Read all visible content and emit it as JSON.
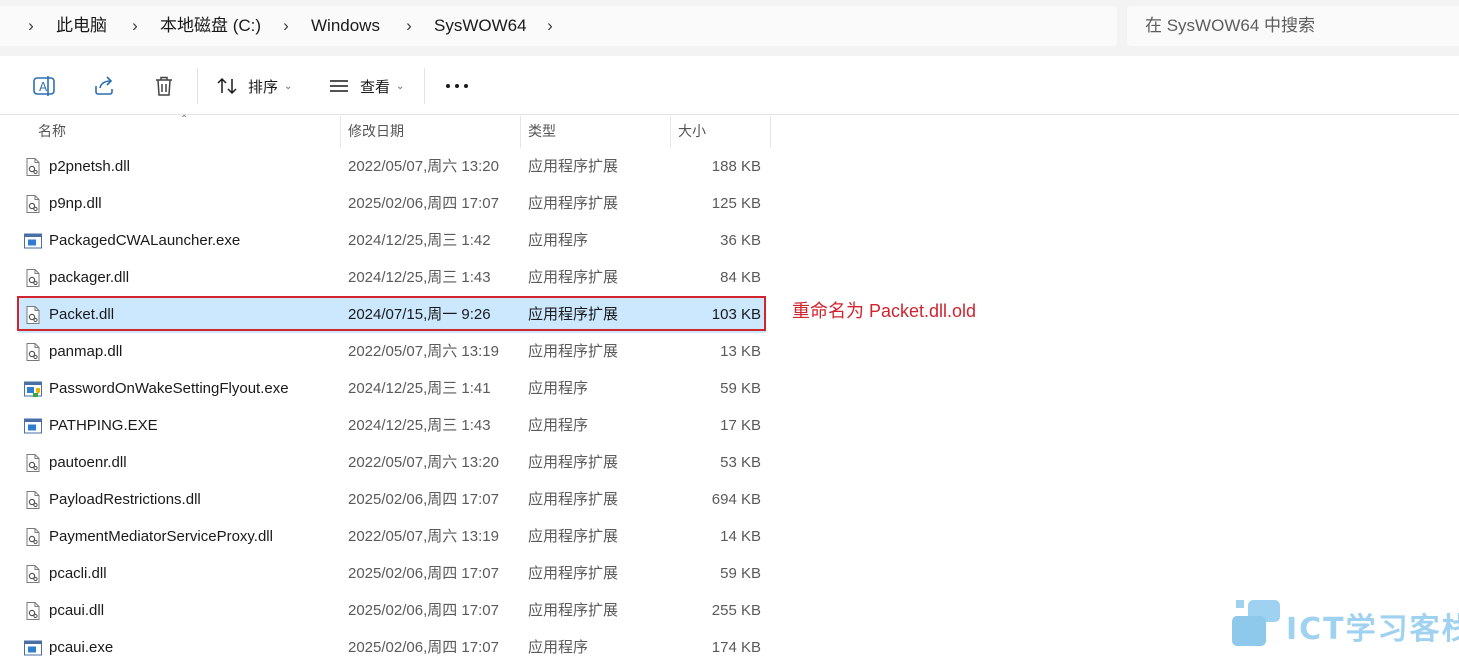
{
  "breadcrumb": {
    "items": [
      "此电脑",
      "本地磁盘 (C:)",
      "Windows",
      "SysWOW64"
    ]
  },
  "search": {
    "placeholder": "在 SysWOW64 中搜索"
  },
  "toolbar": {
    "sort_label": "排序",
    "view_label": "查看",
    "more_icon": "ellipsis-icon"
  },
  "columns": {
    "name": "名称",
    "modified": "修改日期",
    "type": "类型",
    "size": "大小"
  },
  "files": [
    {
      "name": "p2pnetsh.dll",
      "modified": "2022/05/07,周六 13:20",
      "type": "应用程序扩展",
      "size": "188 KB",
      "icon": "dll-icon"
    },
    {
      "name": "p9np.dll",
      "modified": "2025/02/06,周四 17:07",
      "type": "应用程序扩展",
      "size": "125 KB",
      "icon": "dll-icon"
    },
    {
      "name": "PackagedCWALauncher.exe",
      "modified": "2024/12/25,周三 1:42",
      "type": "应用程序",
      "size": "36 KB",
      "icon": "exe-icon"
    },
    {
      "name": "packager.dll",
      "modified": "2024/12/25,周三 1:43",
      "type": "应用程序扩展",
      "size": "84 KB",
      "icon": "dll-icon"
    },
    {
      "name": "Packet.dll",
      "modified": "2024/07/15,周一 9:26",
      "type": "应用程序扩展",
      "size": "103 KB",
      "icon": "dll-icon",
      "selected": true
    },
    {
      "name": "panmap.dll",
      "modified": "2022/05/07,周六 13:19",
      "type": "应用程序扩展",
      "size": "13 KB",
      "icon": "dll-icon"
    },
    {
      "name": "PasswordOnWakeSettingFlyout.exe",
      "modified": "2024/12/25,周三 1:41",
      "type": "应用程序",
      "size": "59 KB",
      "icon": "exe-shield-icon"
    },
    {
      "name": "PATHPING.EXE",
      "modified": "2024/12/25,周三 1:43",
      "type": "应用程序",
      "size": "17 KB",
      "icon": "exe-icon"
    },
    {
      "name": "pautoenr.dll",
      "modified": "2022/05/07,周六 13:20",
      "type": "应用程序扩展",
      "size": "53 KB",
      "icon": "dll-icon"
    },
    {
      "name": "PayloadRestrictions.dll",
      "modified": "2025/02/06,周四 17:07",
      "type": "应用程序扩展",
      "size": "694 KB",
      "icon": "dll-icon"
    },
    {
      "name": "PaymentMediatorServiceProxy.dll",
      "modified": "2022/05/07,周六 13:19",
      "type": "应用程序扩展",
      "size": "14 KB",
      "icon": "dll-icon"
    },
    {
      "name": "pcacli.dll",
      "modified": "2025/02/06,周四 17:07",
      "type": "应用程序扩展",
      "size": "59 KB",
      "icon": "dll-icon"
    },
    {
      "name": "pcaui.dll",
      "modified": "2025/02/06,周四 17:07",
      "type": "应用程序扩展",
      "size": "255 KB",
      "icon": "dll-icon"
    },
    {
      "name": "pcaui.exe",
      "modified": "2025/02/06,周四 17:07",
      "type": "应用程序",
      "size": "174 KB",
      "icon": "exe-icon"
    }
  ],
  "annotation": {
    "text": "重命名为 Packet.dll.old",
    "color": "#d0242e"
  },
  "watermark": {
    "text": "ICT学习客栈"
  },
  "colors": {
    "selection": "#cce8ff",
    "accent": "#0067c0"
  }
}
